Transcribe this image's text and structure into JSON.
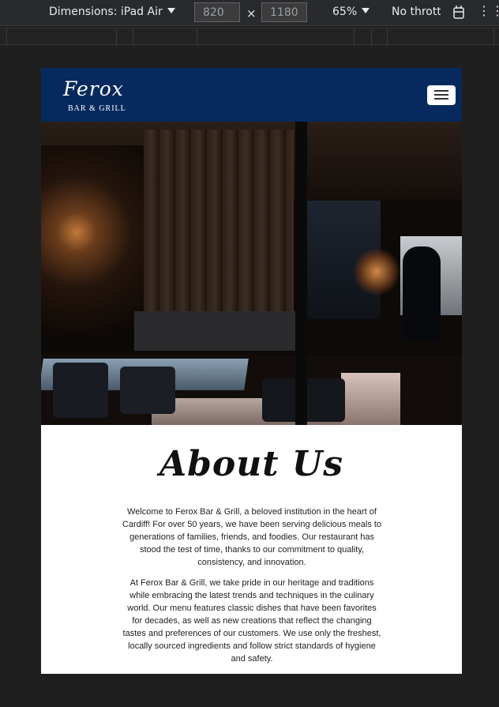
{
  "devtools": {
    "dimensions_label": "Dimensions: iPad Air",
    "width": "820",
    "height": "1180",
    "times": "×",
    "zoom": "65%",
    "throttle": "No throttling",
    "rotate_icon": "rotate-icon",
    "more_icon": "more-icon"
  },
  "site": {
    "logo_script": "Ferox",
    "logo_sub": "BAR & GRILL",
    "menu_icon": "hamburger-icon",
    "hero_alt": "Restaurant interior"
  },
  "about": {
    "title": "About Us",
    "paragraph1": "Welcome to Ferox Bar & Grill, a beloved institution in the heart of Cardiff! For over 50 years, we have been serving delicious meals to generations of families, friends, and foodies. Our restaurant has stood the test of time, thanks to our commitment to quality, consistency, and innovation.",
    "paragraph2": "At Ferox Bar & Grill, we take pride in our heritage and traditions while embracing the latest trends and techniques in the culinary world. Our menu features classic dishes that have been favorites for decades, as well as new creations that reflect the changing tastes and preferences of our customers. We use only the freshest, locally sourced ingredients and follow strict standards of hygiene and safety."
  },
  "colors": {
    "header_bg": "#062a5e",
    "page_bg": "#1f1f1f"
  }
}
